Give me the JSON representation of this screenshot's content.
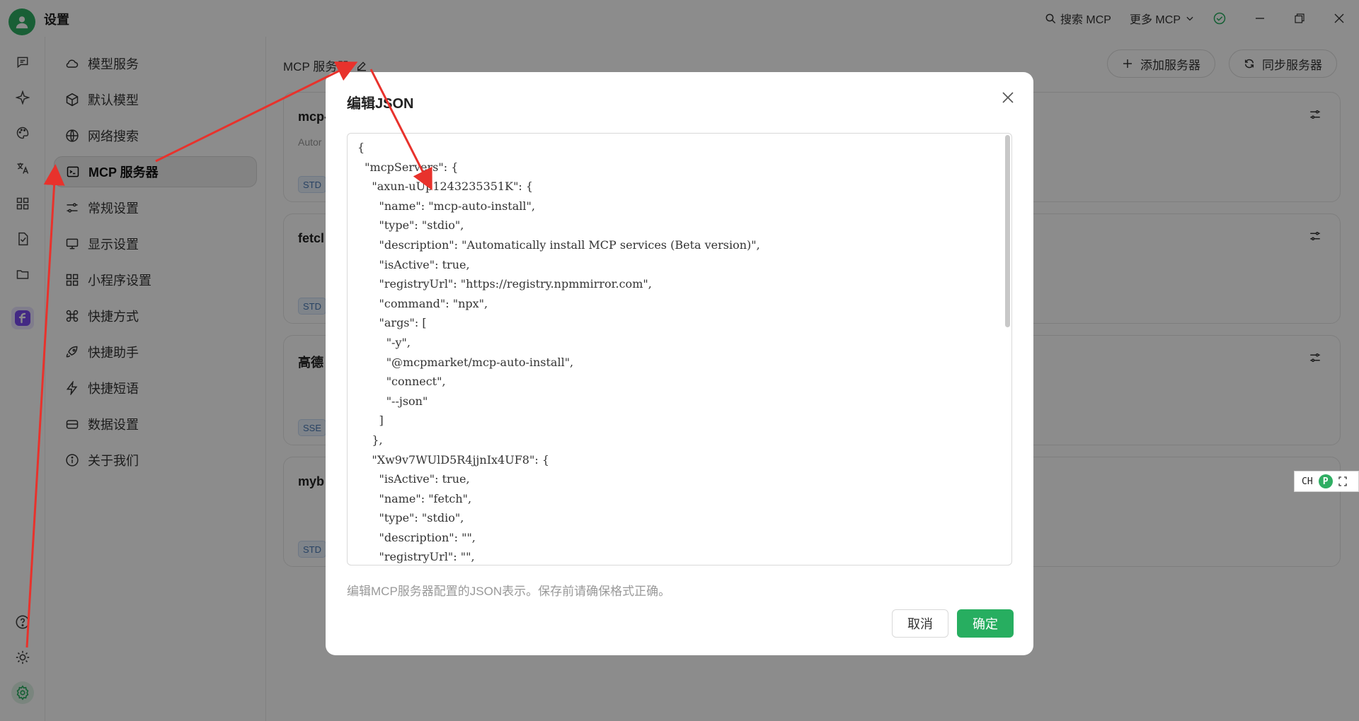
{
  "window": {
    "title": "设置",
    "search_label": "搜索 MCP",
    "more_label": "更多 MCP"
  },
  "sidebar": {
    "items": [
      {
        "label": "模型服务",
        "icon": "cloud-icon"
      },
      {
        "label": "默认模型",
        "icon": "cube-icon"
      },
      {
        "label": "网络搜索",
        "icon": "globe-icon"
      },
      {
        "label": "MCP 服务器",
        "icon": "terminal-icon"
      },
      {
        "label": "常规设置",
        "icon": "sliders-icon"
      },
      {
        "label": "显示设置",
        "icon": "monitor-icon"
      },
      {
        "label": "小程序设置",
        "icon": "grid-icon"
      },
      {
        "label": "快捷方式",
        "icon": "command-icon"
      },
      {
        "label": "快捷助手",
        "icon": "rocket-icon"
      },
      {
        "label": "快捷短语",
        "icon": "zap-icon"
      },
      {
        "label": "数据设置",
        "icon": "database-icon"
      },
      {
        "label": "关于我们",
        "icon": "info-icon"
      }
    ],
    "active_index": 3
  },
  "main": {
    "title": "MCP 服务器",
    "add_button": "添加服务器",
    "sync_button": "同步服务器",
    "cards": [
      {
        "name": "mcp-",
        "desc": "Autor",
        "tag": "STD"
      },
      {
        "name": "fetcl",
        "desc": "",
        "tag": "STD"
      },
      {
        "name": "高德",
        "desc": "",
        "tag": "SSE"
      },
      {
        "name": "myb",
        "desc": "",
        "tag": "STD"
      }
    ]
  },
  "modal": {
    "title": "编辑JSON",
    "json_text": "{\n  \"mcpServers\": {\n    \"axun-uUp1243235351K\": {\n      \"name\": \"mcp-auto-install\",\n      \"type\": \"stdio\",\n      \"description\": \"Automatically install MCP services (Beta version)\",\n      \"isActive\": true,\n      \"registryUrl\": \"https://registry.npmmirror.com\",\n      \"command\": \"npx\",\n      \"args\": [\n        \"-y\",\n        \"@mcpmarket/mcp-auto-install\",\n        \"connect\",\n        \"--json\"\n      ]\n    },\n    \"Xw9v7WUlD5R4jjnIx4UF8\": {\n      \"isActive\": true,\n      \"name\": \"fetch\",\n      \"type\": \"stdio\",\n      \"description\": \"\",\n      \"registryUrl\": \"\",",
    "hint": "编辑MCP服务器配置的JSON表示。保存前请确保格式正确。",
    "cancel_label": "取消",
    "ok_label": "确定"
  },
  "ime": {
    "label": "CH",
    "badge": "P"
  },
  "colors": {
    "accent": "#27ae60",
    "overlay": "rgba(0,0,0,0.45)",
    "annotation_arrow": "#e8322c"
  }
}
